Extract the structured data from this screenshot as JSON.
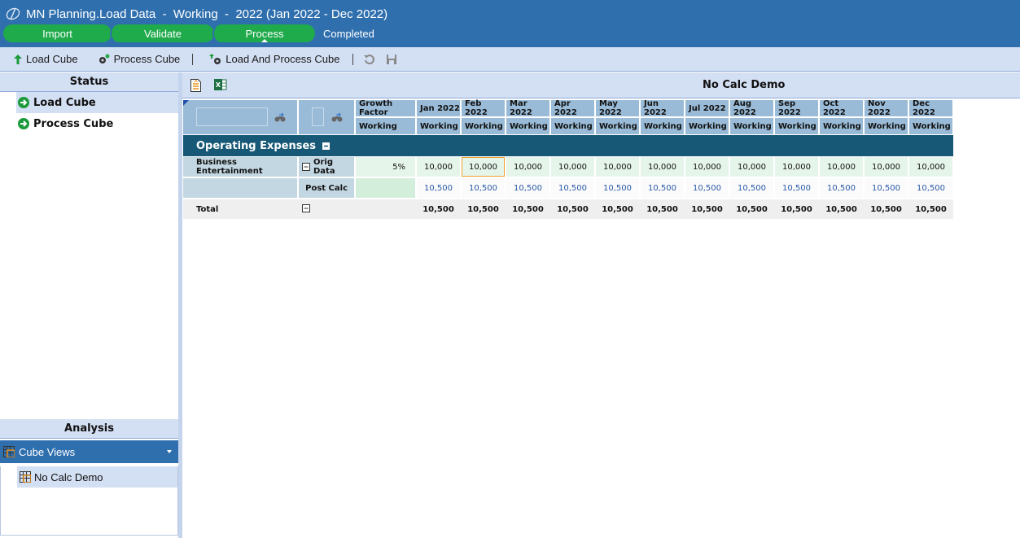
{
  "titlebar": {
    "title": "MN Planning.Load Data  -  Working  -  2022 (Jan 2022 - Dec 2022)",
    "steps": [
      "Import",
      "Validate",
      "Process"
    ],
    "current_step": "Process",
    "completed_label": "Completed"
  },
  "toolbar": {
    "load_cube": "Load Cube",
    "process_cube": "Process Cube",
    "load_and_process_cube": "Load And Process Cube"
  },
  "status_panel": {
    "title": "Status",
    "items": [
      {
        "label": "Load Cube",
        "selected": true
      },
      {
        "label": "Process Cube",
        "selected": false
      }
    ]
  },
  "analysis_panel": {
    "title": "Analysis",
    "dropdown_label": "Cube Views",
    "items": [
      {
        "label": "No Calc Demo",
        "selected": true
      }
    ]
  },
  "main": {
    "title": "No Calc Demo",
    "columns": [
      {
        "top": "Growth Factor",
        "bottom": "Working"
      },
      {
        "top": "Jan 2022",
        "bottom": "Working"
      },
      {
        "top": "Feb 2022",
        "bottom": "Working"
      },
      {
        "top": "Mar 2022",
        "bottom": "Working"
      },
      {
        "top": "Apr 2022",
        "bottom": "Working"
      },
      {
        "top": "May 2022",
        "bottom": "Working"
      },
      {
        "top": "Jun 2022",
        "bottom": "Working"
      },
      {
        "top": "Jul 2022",
        "bottom": "Working"
      },
      {
        "top": "Aug 2022",
        "bottom": "Working"
      },
      {
        "top": "Sep 2022",
        "bottom": "Working"
      },
      {
        "top": "Oct 2022",
        "bottom": "Working"
      },
      {
        "top": "Nov 2022",
        "bottom": "Working"
      },
      {
        "top": "Dec 2022",
        "bottom": "Working"
      }
    ],
    "group_label": "Operating Expenses",
    "rows": [
      {
        "account": "Business Entertainment",
        "type": "Orig Data",
        "growth": "5%",
        "values": [
          "10,000",
          "10,000",
          "10,000",
          "10,000",
          "10,000",
          "10,000",
          "10,000",
          "10,000",
          "10,000",
          "10,000",
          "10,000",
          "10,000"
        ]
      },
      {
        "account": "",
        "type": "Post Calc",
        "growth": "",
        "values": [
          "10,500",
          "10,500",
          "10,500",
          "10,500",
          "10,500",
          "10,500",
          "10,500",
          "10,500",
          "10,500",
          "10,500",
          "10,500",
          "10,500"
        ]
      }
    ],
    "total": {
      "label": "Total",
      "values": [
        "10,500",
        "10,500",
        "10,500",
        "10,500",
        "10,500",
        "10,500",
        "10,500",
        "10,500",
        "10,500",
        "10,500",
        "10,500",
        "10,500"
      ]
    },
    "selected_cell": {
      "row": 0,
      "column": "Feb 2022"
    }
  },
  "colors": {
    "titlebar": "#2f6fae",
    "step_green": "#1faa4b",
    "group_band": "#165876",
    "header_cell": "#99bbd7",
    "orig_row": "#e6f5ea",
    "post_calc_text": "#2a5aa8",
    "total_row": "#efefef",
    "selected_border": "#f0a030"
  }
}
